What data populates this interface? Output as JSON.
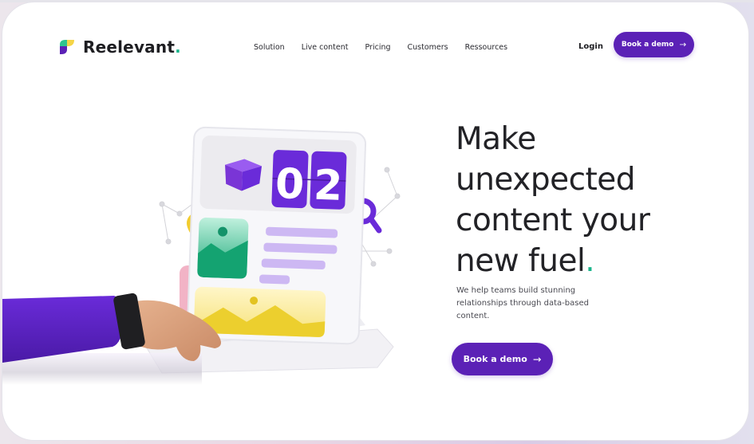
{
  "brand": {
    "name": "Reelevant",
    "dot": ".",
    "colors": {
      "primary": "#5b21b6",
      "accent_green": "#1bb58b",
      "logo_yellow": "#f5d547",
      "logo_green": "#2ec48f",
      "logo_purple": "#5b21b6"
    }
  },
  "nav": {
    "items": [
      {
        "label": "Solution"
      },
      {
        "label": "Live content"
      },
      {
        "label": "Pricing"
      },
      {
        "label": "Customers"
      },
      {
        "label": "Ressources"
      }
    ],
    "login_label": "Login",
    "cta_label": "Book a demo",
    "cta_icon": "arrow-right-icon"
  },
  "hero": {
    "headline_lines": [
      "Make",
      "unexpected",
      "content your",
      "new fuel"
    ],
    "headline_dot": ".",
    "subtext": "We help teams build stunning relationships through data-based content.",
    "cta_label": "Book a demo",
    "cta_icon": "arrow-right-icon",
    "illustration": {
      "counter_digits": [
        "0",
        "2"
      ],
      "description": "hand tapping a tablet showing a 02 counter, box, image cards and text lines"
    }
  }
}
